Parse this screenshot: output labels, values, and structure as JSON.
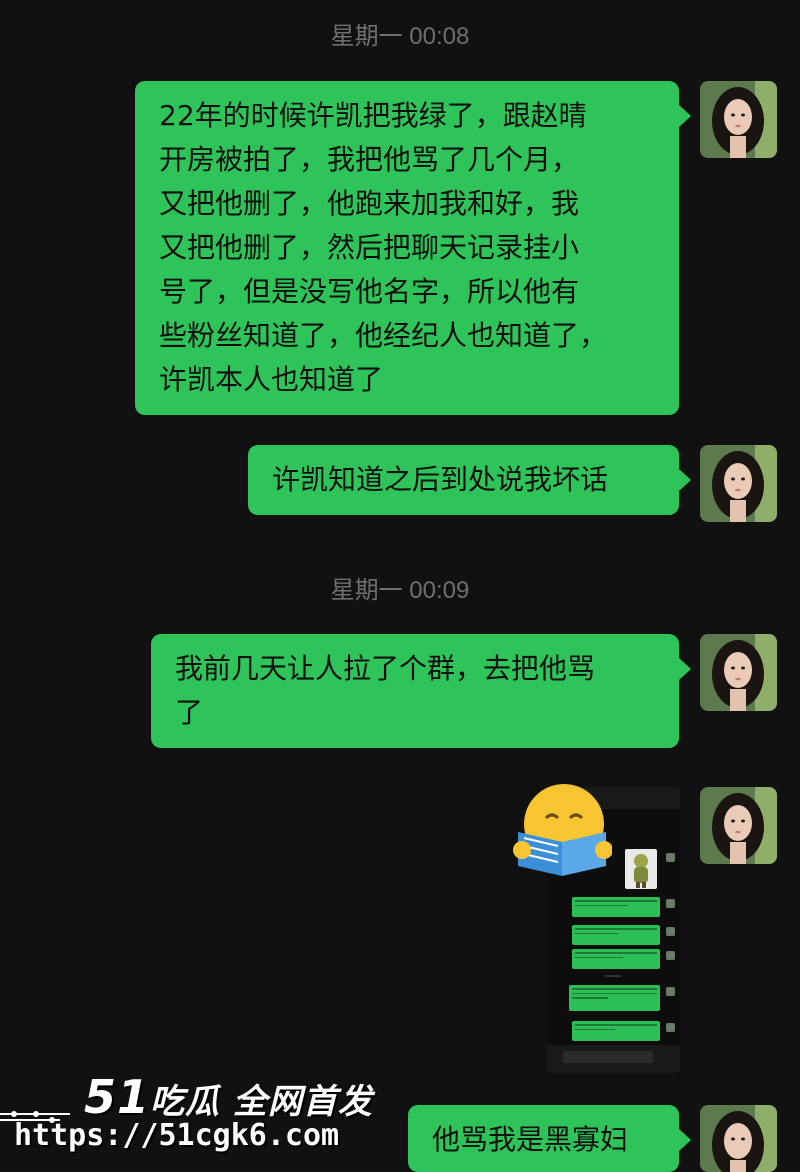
{
  "chat": {
    "timestamp_1": "星期一 00:08",
    "timestamp_2": "星期一 00:09",
    "messages": [
      {
        "lines": [
          "22年的时候许凯把我绿了，跟赵晴",
          "开房被拍了，我把他骂了几个月，",
          "又把他删了，他跑来加我和好，我",
          "又把他删了，然后把聊天记录挂小",
          "号了，但是没写他名字，所以他有",
          "些粉丝知道了，他经纪人也知道了，",
          "许凯本人也知道了"
        ]
      },
      {
        "lines": [
          "许凯知道之后到处说我坏话"
        ]
      },
      {
        "lines": [
          "我前几天让人拉了个群，去把他骂",
          "了"
        ]
      },
      {
        "lines": [
          "他骂我是黑寡妇"
        ]
      }
    ],
    "image_message": {
      "emoji": "reading-emoji",
      "type": "screenshot"
    }
  },
  "watermark": {
    "brand_number": "51",
    "brand_text": "吃瓜 全网首发",
    "url": "https://51cgk6.com"
  },
  "colors": {
    "background": "#111111",
    "bubble": "#2ec45a",
    "timestamp": "#6f6f6f"
  }
}
